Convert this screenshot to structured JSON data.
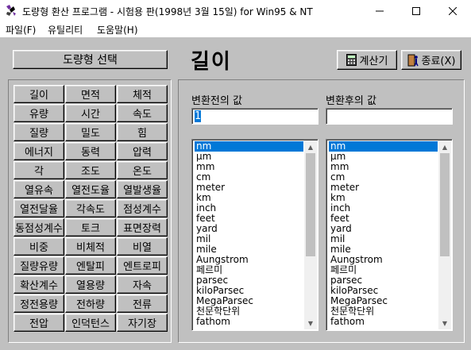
{
  "window": {
    "title": "도량형 환산 프로그램  - 시험용 판(1998년 3월 15일)  for Win95 & NT",
    "minimize_icon": "minimize-icon",
    "maximize_icon": "maximize-icon",
    "close_icon": "close-icon"
  },
  "menu": [
    "파일(F)",
    "유틸리티",
    "도움말(H)"
  ],
  "select_button": "도량형 선택",
  "categories": [
    "길이",
    "면적",
    "체적",
    "유량",
    "시간",
    "속도",
    "질량",
    "밀도",
    "힘",
    "에너지",
    "동력",
    "압력",
    "각",
    "조도",
    "온도",
    "열유속",
    "열전도율",
    "열발생율",
    "열전달율",
    "각속도",
    "점성계수",
    "동점성계수",
    "토크",
    "표면장력",
    "비중",
    "비체적",
    "비열",
    "질량유량",
    "엔탈피",
    "엔트로피",
    "확산계수",
    "열용량",
    "자속",
    "정전용량",
    "전하량",
    "전류",
    "전압",
    "인덕턴스",
    "자기장"
  ],
  "current_category": "길이",
  "calc_button": "계산기",
  "exit_button": "종료(X)",
  "before_label": "변환전의 값",
  "after_label": "변환후의 값",
  "before_value": "1",
  "after_value": "",
  "units": [
    "nm",
    "μm",
    "mm",
    "cm",
    "meter",
    "km",
    "inch",
    "feet",
    "yard",
    "mil",
    "mile",
    "Aungstrom",
    "페르미",
    "parsec",
    "kiloParsec",
    "MegaParsec",
    "천문학단위",
    "fathom"
  ],
  "selected_unit_index": 0
}
